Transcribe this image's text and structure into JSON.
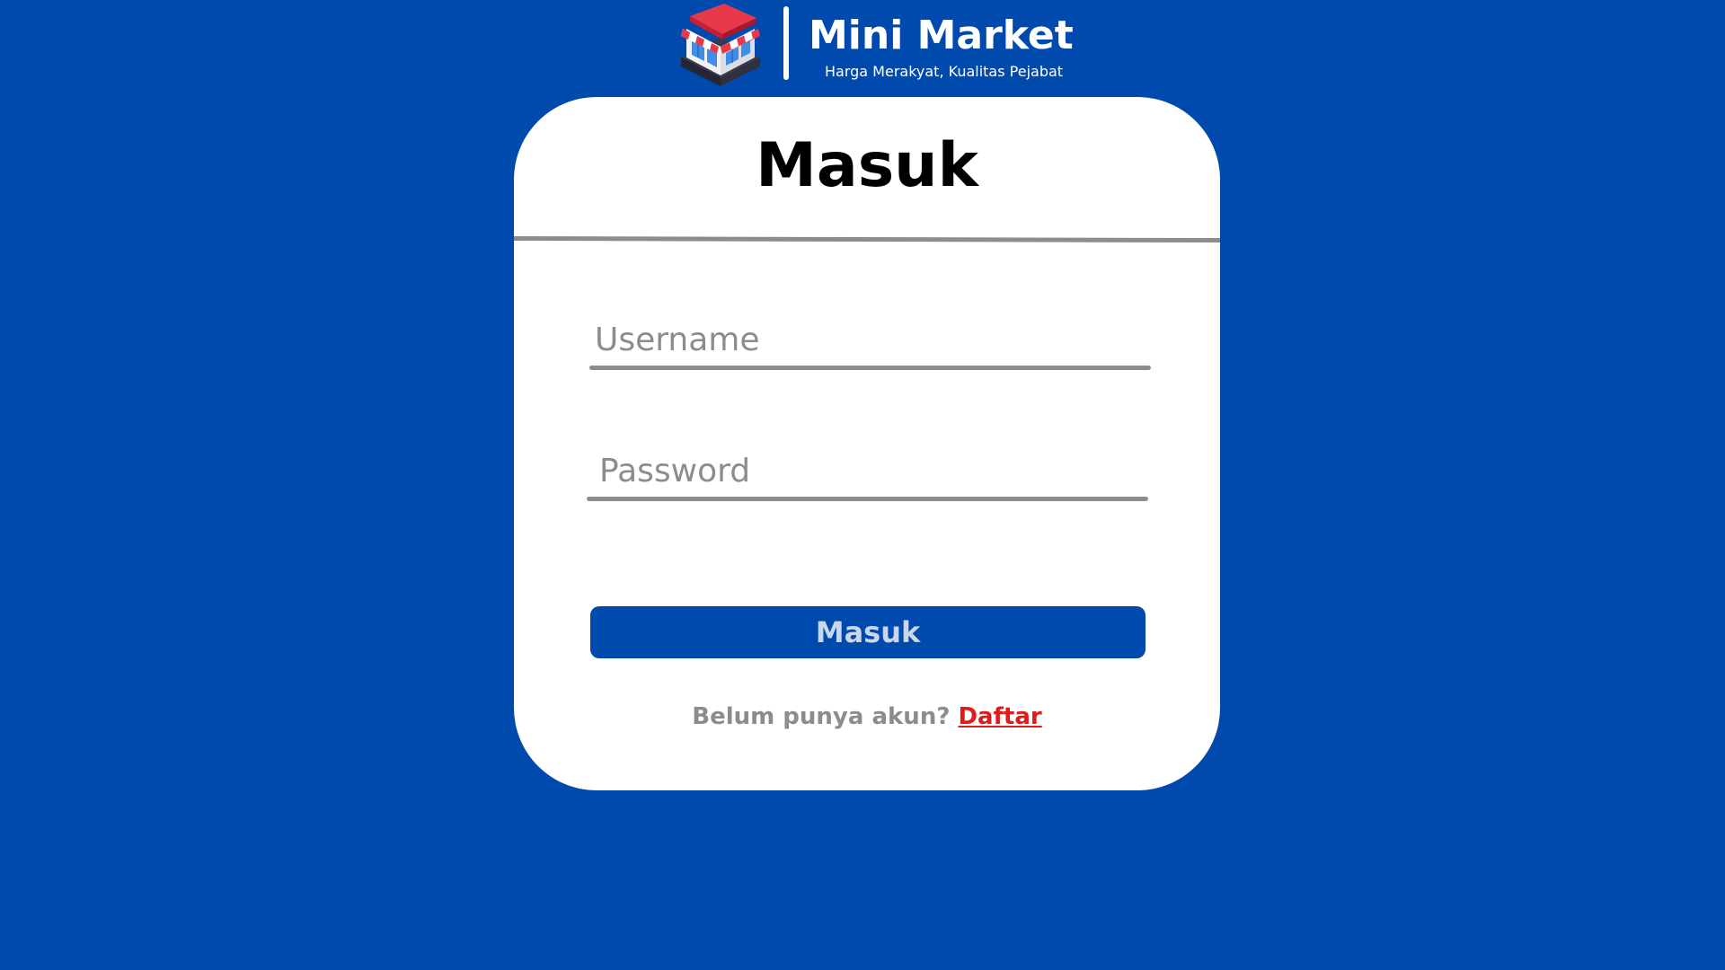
{
  "brand": {
    "name": "Mini Market",
    "tagline": "Harga Merakyat, Kualitas Pejabat",
    "logo_icon": "storefront-icon"
  },
  "login_form": {
    "title": "Masuk",
    "username": {
      "placeholder": "Username",
      "value": ""
    },
    "password": {
      "placeholder": "Password",
      "value": ""
    },
    "submit_label": "Masuk",
    "register_prompt": "Belum punya akun?",
    "register_link": "Daftar"
  },
  "colors": {
    "background": "#004aad",
    "card": "#ffffff",
    "button": "#004aad",
    "button_text": "#c9d6ec",
    "muted": "#8c8c8c",
    "link": "#e01b1b"
  }
}
